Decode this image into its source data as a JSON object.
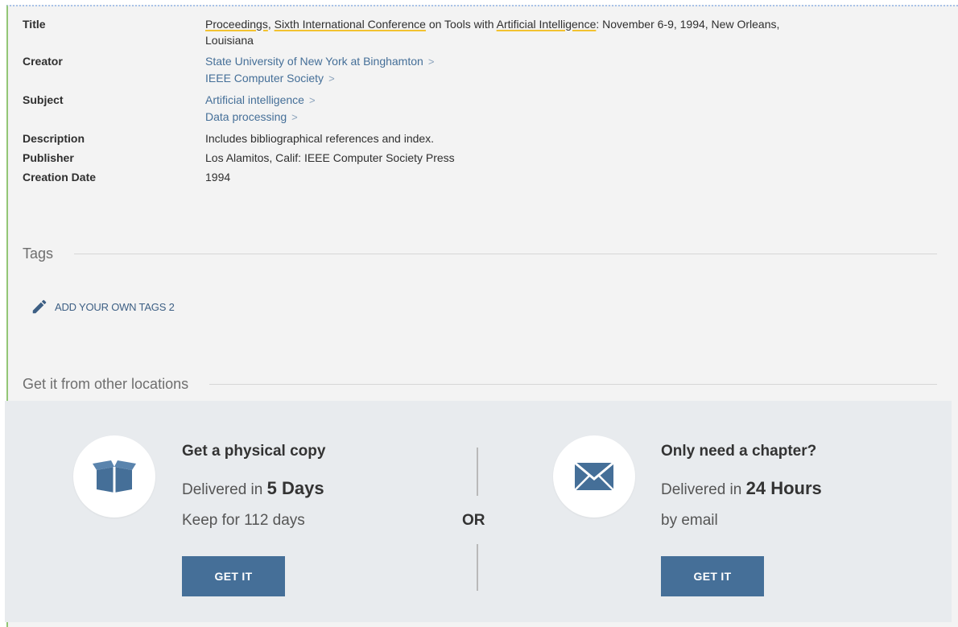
{
  "record": {
    "title": {
      "label": "Title",
      "part1": "Proceedings",
      "part2": ", ",
      "part3": "Sixth International Conference",
      "part4": " on Tools with ",
      "part5": "Artificial Intelligence",
      "part6": ": November 6-9, 1994, New Orleans,",
      "line2": "Louisiana"
    },
    "creator": {
      "label": "Creator",
      "items": [
        "State University of New York at Binghamton",
        "IEEE Computer Society"
      ]
    },
    "subject": {
      "label": "Subject",
      "items": [
        "Artificial intelligence",
        "Data processing"
      ]
    },
    "description": {
      "label": "Description",
      "value": "Includes bibliographical references and index."
    },
    "publisher": {
      "label": "Publisher",
      "value": "Los Alamitos, Calif: IEEE Computer Society Press"
    },
    "creation_date": {
      "label": "Creation Date",
      "value": "1994"
    },
    "chevron": ">"
  },
  "tags": {
    "heading": "Tags",
    "add_label": "ADD YOUR OWN TAGS 2"
  },
  "locations": {
    "heading": "Get it from other locations",
    "physical": {
      "title": "Get a physical copy",
      "delivered_prefix": "Delivered in ",
      "delivered_value": "5 Days",
      "keep": "Keep for 112 days",
      "button": "GET IT",
      "icon": "box-icon"
    },
    "separator": "OR",
    "chapter": {
      "title": "Only need a chapter?",
      "delivered_prefix": "Delivered in ",
      "delivered_value": "24 Hours",
      "method": "by email",
      "button": "GET IT",
      "icon": "envelope-icon"
    }
  },
  "colors": {
    "accent": "#456f98",
    "link": "#456f98",
    "highlight": "#f2c230",
    "panel": "#e8ebee",
    "background": "#f3f3f3"
  }
}
